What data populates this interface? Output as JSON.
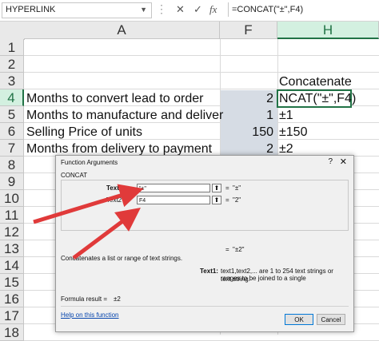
{
  "formula_bar": {
    "name_box": "HYPERLINK",
    "dots": "⋮",
    "cancel_glyph": "✕",
    "enter_glyph": "✓",
    "fx_glyph": "fx",
    "formula": "=CONCAT(\"±\",F4)"
  },
  "columns": [
    "A",
    "F",
    "H"
  ],
  "rows": [
    "1",
    "2",
    "3",
    "4",
    "5",
    "6",
    "7",
    "8",
    "9",
    "10",
    "11",
    "12",
    "13",
    "14",
    "15",
    "16",
    "17",
    "18"
  ],
  "cells": {
    "H3": "Concatenate",
    "A4": "Months to convert lead to order",
    "F4": "2",
    "H4": "NCAT(\"±\",F4)",
    "A5": "Months to manufacture and deliver",
    "F5": "1",
    "H5": "±1",
    "A6": "Selling Price of units",
    "F6": "150",
    "H6": "±150",
    "A7": "Months from delivery to payment",
    "F7": "2",
    "H7": "±2"
  },
  "dialog": {
    "title": "Function Arguments",
    "help_glyph": "?",
    "close_glyph": "✕",
    "function_name": "CONCAT",
    "args": [
      {
        "label": "Text1",
        "value": "\"±\"",
        "result": "\"±\""
      },
      {
        "label": "Text2",
        "value": "F4",
        "result": "\"2\""
      }
    ],
    "ref_glyph": "⬆",
    "equals": "=",
    "overall_result": "\"±2\"",
    "description": "Concatenates a list or range of text strings.",
    "arg_help_label": "Text1:",
    "arg_help_text_line1": "text1,text2,... are 1 to 254 text strings or ranges to be joined to a single",
    "arg_help_text_line2": "text string.",
    "formula_result_label": "Formula result =",
    "formula_result_value": "±2",
    "help_link": "Help on this function",
    "ok_label": "OK",
    "cancel_label": "Cancel"
  },
  "colors": {
    "excel_green": "#217346",
    "shade": "#d6dce4",
    "arrow_red": "#e03a3a"
  }
}
